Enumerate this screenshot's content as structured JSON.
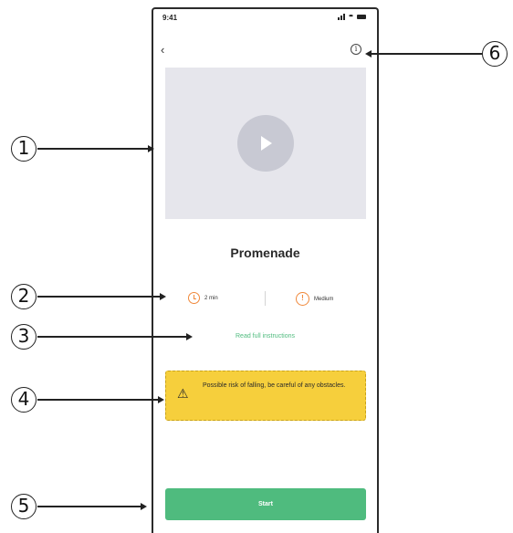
{
  "status_bar": {
    "time": "9:41"
  },
  "screen": {
    "title": "Promenade",
    "duration": "2 min",
    "level": "Medium",
    "level_icon_glyph": "!",
    "instructions_link": "Read full instructions",
    "warning_text": "Possible risk of falling, be careful of any obstacles.",
    "start_label": "Start",
    "back_icon": "chevron-left-icon",
    "info_icon_glyph": "i"
  },
  "callouts": [
    "1",
    "2",
    "3",
    "4",
    "5",
    "6"
  ],
  "colors": {
    "accent_green": "#4fbb7e",
    "warning_yellow": "#f6cf3c",
    "icon_orange": "#f0883a",
    "video_placeholder": "#e6e6ec"
  }
}
